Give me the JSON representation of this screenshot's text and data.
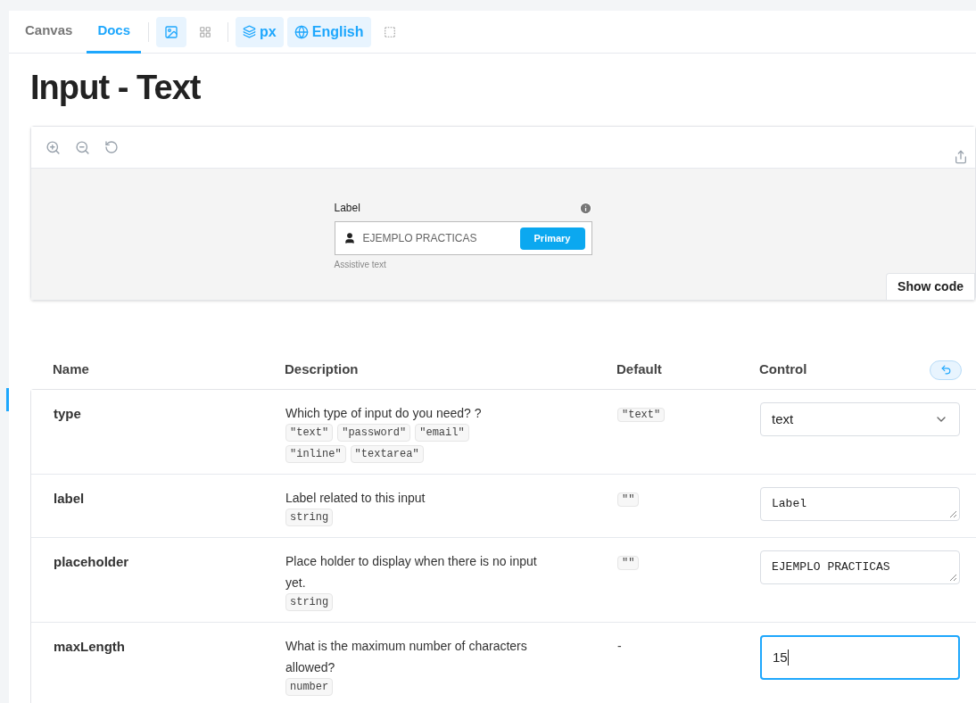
{
  "tabs": [
    {
      "label": "Canvas",
      "selected": false
    },
    {
      "label": "Docs",
      "selected": true
    }
  ],
  "toolbar": {
    "buttons": [
      {
        "kind": "image",
        "selected": true
      },
      {
        "kind": "grid",
        "selected": false
      }
    ],
    "unit": "px",
    "language": "English"
  },
  "title": "Input - Text",
  "preview": {
    "label": "Label",
    "placeholder": "EJEMPLO PRACTICAS",
    "button": "Primary",
    "helper": "Assistive text",
    "show_code": "Show code"
  },
  "table": {
    "columns": [
      "Name",
      "Description",
      "Default",
      "Control"
    ],
    "rows": [
      {
        "name": "type",
        "description": "Which type of input do you need? ?",
        "types": [
          "\"text\"",
          "\"password\"",
          "\"email\"",
          "\"inline\"",
          "\"textarea\""
        ],
        "default": "\"text\"",
        "control": {
          "kind": "select",
          "value": "text",
          "focused": false
        }
      },
      {
        "name": "label",
        "description": "Label related to this input",
        "types": [
          "string"
        ],
        "default": "\"\"",
        "control": {
          "kind": "textarea",
          "value": "Label",
          "focused": false
        }
      },
      {
        "name": "placeholder",
        "description": "Place holder to display when there is no input yet.",
        "types": [
          "string"
        ],
        "default": "\"\"",
        "control": {
          "kind": "textarea",
          "value": "EJEMPLO PRACTICAS",
          "focused": false
        }
      },
      {
        "name": "maxLength",
        "description": "What is the maximum number of characters allowed?",
        "types": [
          "number"
        ],
        "default": "-",
        "control": {
          "kind": "input",
          "value": "15",
          "focused": true
        }
      }
    ]
  }
}
